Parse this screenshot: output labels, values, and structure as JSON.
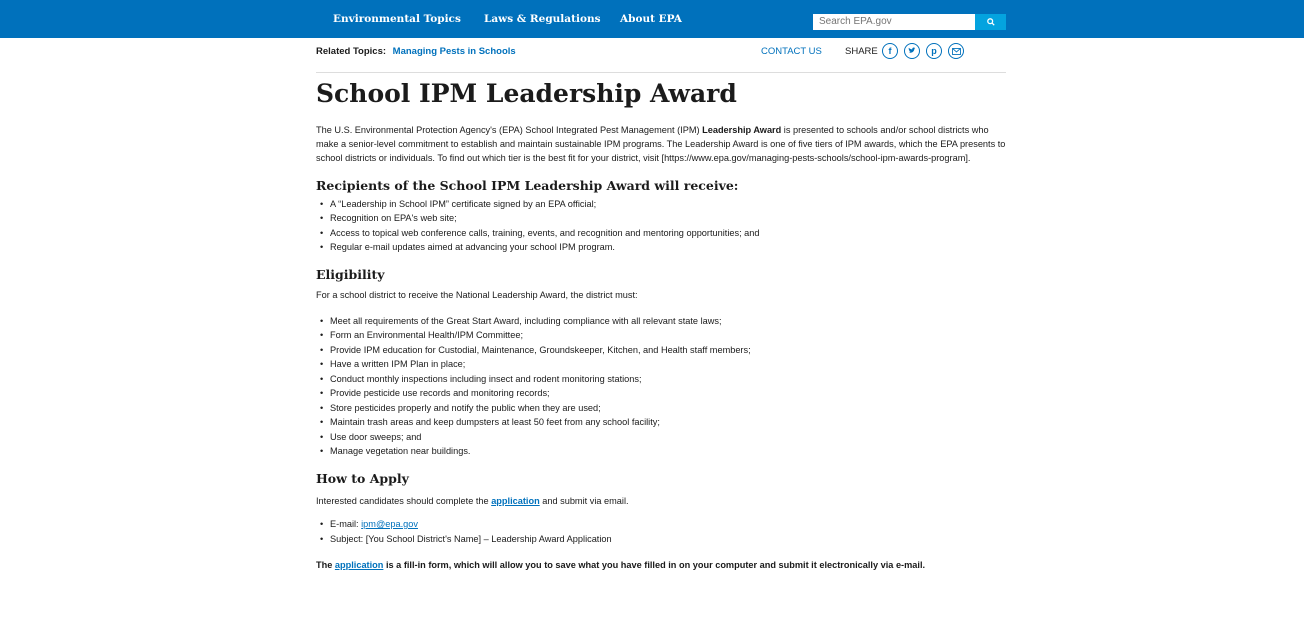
{
  "nav": {
    "items": [
      "Environmental Topics",
      "Laws & Regulations",
      "About EPA"
    ],
    "search_placeholder": "Search EPA.gov"
  },
  "subbar": {
    "related_label": "Related Topics:",
    "related_link": "Managing Pests in Schools",
    "contact": "CONTACT US",
    "share": "SHARE"
  },
  "page": {
    "title": "School IPM Leadership Award",
    "intro_pre": "The U.S. Environmental Protection Agency's (EPA) School Integrated Pest Management (IPM) ",
    "intro_bold": "Leadership Award",
    "intro_post": " is presented to schools and/or school districts who make a senior-level commitment to establish and maintain sustainable IPM programs. The Leadership Award is one of five tiers of IPM awards, which the EPA presents to school districts or individuals. To find out which tier is the best fit for your district, visit [https://www.epa.gov/managing-pests-schools/school-ipm-awards-program].",
    "recipients_heading": "Recipients of the School IPM Leadership Award will receive:",
    "recipients": [
      "A “Leadership in School IPM” certificate signed by an EPA official;",
      "Recognition on EPA's web site;",
      "Access to topical web conference calls, training, events, and recognition and mentoring opportunities; and",
      "Regular e-mail updates aimed at advancing your school IPM program."
    ],
    "eligibility_heading": "Eligibility",
    "eligibility_intro": "For a school district to receive the National Leadership Award, the district must:",
    "eligibility": [
      "Meet all requirements of the Great Start Award, including compliance with all relevant state laws;",
      "Form an Environmental Health/IPM Committee;",
      "Provide IPM education for Custodial, Maintenance, Groundskeeper, Kitchen, and Health staff members;",
      "Have a written IPM Plan in place;",
      "Conduct monthly inspections including insect and rodent monitoring stations;",
      "Provide pesticide use records and monitoring records;",
      "Store pesticides properly and notify the public when they are used;",
      "Maintain trash areas and keep dumpsters at least 50 feet from any school facility;",
      "Use door sweeps; and",
      "Manage vegetation near buildings."
    ],
    "apply_heading": "How to Apply",
    "apply_pre": "Interested candidates should complete the ",
    "apply_link": "application",
    "apply_post": " and submit via email.",
    "email_label": "E-mail: ",
    "email_link": "ipm@epa.gov",
    "subject": "Subject: [You School District's Name] – Leadership Award Application",
    "final_pre": "The ",
    "final_link": "application",
    "final_post": " is a fill-in form, which will allow you to save what you have filled in on your computer and submit it electronically via e-mail."
  },
  "icons": {
    "search": "search-icon",
    "facebook": "facebook-icon",
    "twitter": "twitter-icon",
    "pinterest": "pinterest-icon",
    "email": "email-icon"
  },
  "colors": {
    "header_blue": "#0071bc",
    "search_button": "#04a3df",
    "link": "#0071bc"
  }
}
